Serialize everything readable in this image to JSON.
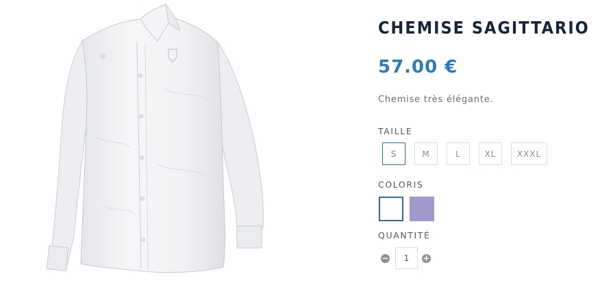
{
  "product": {
    "name": "CHEMISE SAGITTARIO",
    "price": "57.00 €",
    "description": "Chemise très élégante.",
    "image_icon": "white-long-sleeve-shirt"
  },
  "size": {
    "label": "TAILLE",
    "options": [
      "S",
      "M",
      "L",
      "XL",
      "XXXL"
    ],
    "selected": "S"
  },
  "color": {
    "label": "COLORIS",
    "options": [
      {
        "name": "white",
        "hex": "#ffffff"
      },
      {
        "name": "lavender",
        "hex": "#a298cc"
      }
    ],
    "selected": "white"
  },
  "quantity": {
    "label": "QUANTITÉ",
    "value": "1",
    "minus_icon": "minus-circle-icon",
    "plus_icon": "plus-circle-icon"
  },
  "colors": {
    "title": "#14243a",
    "price": "#2f7bb2",
    "selected_border": "#2d6f94"
  }
}
